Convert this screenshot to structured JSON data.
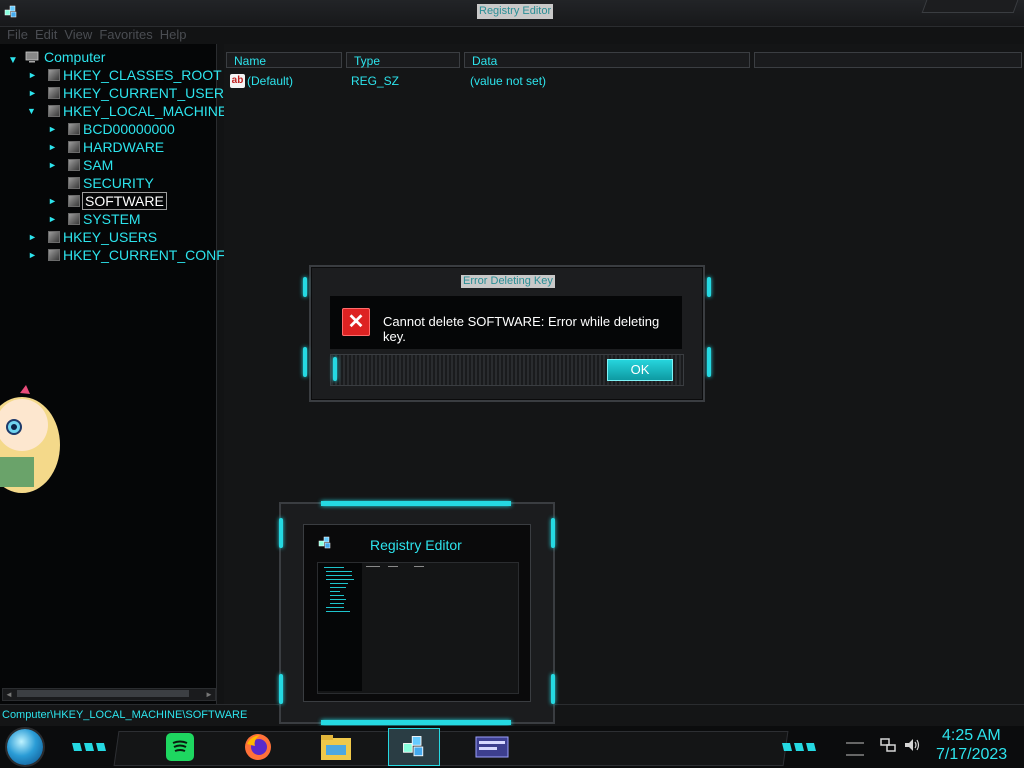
{
  "window": {
    "title": "Registry Editor",
    "app_icon": "registry-editor-icon"
  },
  "menu": [
    "File",
    "Edit",
    "View",
    "Favorites",
    "Help"
  ],
  "tree": {
    "root": "Computer",
    "hives": [
      {
        "label": "HKEY_CLASSES_ROOT",
        "expanded": false
      },
      {
        "label": "HKEY_CURRENT_USER",
        "expanded": false
      },
      {
        "label": "HKEY_LOCAL_MACHINE",
        "expanded": true
      },
      {
        "label": "HKEY_USERS",
        "expanded": false
      },
      {
        "label": "HKEY_CURRENT_CONFI",
        "expanded": false
      }
    ],
    "hklm_children": [
      "BCD00000000",
      "HARDWARE",
      "SAM",
      "SECURITY",
      "SOFTWARE",
      "SYSTEM"
    ],
    "selected": "SOFTWARE"
  },
  "list": {
    "columns": [
      "Name",
      "Type",
      "Data"
    ],
    "rows": [
      {
        "name": "(Default)",
        "type": "REG_SZ",
        "data": "(value not set)",
        "icon": "string-value-icon"
      }
    ]
  },
  "status": {
    "path": "Computer\\HKEY_LOCAL_MACHINE\\SOFTWARE"
  },
  "dialog": {
    "title": "Error Deleting Key",
    "message": "Cannot delete SOFTWARE:  Error while deleting key.",
    "ok_label": "OK",
    "icon": "error-icon"
  },
  "preview": {
    "title": "Registry Editor"
  },
  "taskbar": {
    "apps": [
      "spotify-icon",
      "firefox-icon",
      "file-explorer-icon",
      "registry-editor-icon",
      "system-info-icon"
    ],
    "time": "4:25 AM",
    "date": "7/17/2023",
    "tray": [
      "network-icon",
      "volume-icon"
    ]
  },
  "colors": {
    "accent": "#2de4ed",
    "background": "#121314",
    "error": "#dd2222"
  }
}
